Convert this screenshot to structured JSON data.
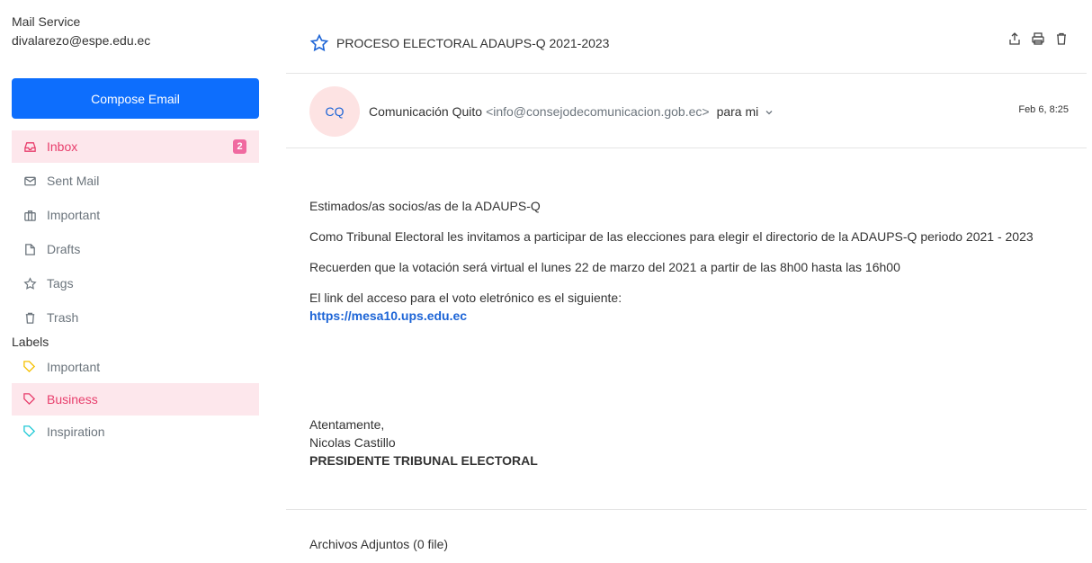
{
  "account": {
    "service": "Mail Service",
    "email": "divalarezo@espe.edu.ec"
  },
  "compose_label": "Compose Email",
  "nav": [
    {
      "label": "Inbox",
      "icon": "inbox-icon",
      "badge": "2",
      "active": true
    },
    {
      "label": "Sent Mail",
      "icon": "envelope-icon"
    },
    {
      "label": "Important",
      "icon": "briefcase-icon"
    },
    {
      "label": "Drafts",
      "icon": "file-icon"
    },
    {
      "label": "Tags",
      "icon": "star-icon"
    },
    {
      "label": "Trash",
      "icon": "trash-icon"
    }
  ],
  "labels_title": "Labels",
  "labels": [
    {
      "label": "Important",
      "color": "#f5c000"
    },
    {
      "label": "Business",
      "color": "#e83e6c",
      "active": true
    },
    {
      "label": "Inspiration",
      "color": "#20c9d6"
    }
  ],
  "message": {
    "subject": "PROCESO ELECTORAL ADAUPS-Q 2021-2023",
    "avatar_initials": "CQ",
    "sender_name": "Comunicación Quito",
    "sender_email": "<info@consejodecomunicacion.gob.ec>",
    "to_label": "para mi",
    "date": "Feb 6, 8:25",
    "greeting": "Estimados/as socios/as de la ADAUPS-Q",
    "p1": "Como Tribunal Electoral les invitamos a participar de las elecciones para elegir el directorio de la ADAUPS-Q periodo 2021 - 2023",
    "p2": "Recuerden que la votación será virtual el lunes 22 de marzo del 2021 a partir de las 8h00 hasta las 16h00",
    "p3": "El link del acceso para el voto eletrónico es el siguiente:",
    "link": "https://mesa10.ups.edu.ec",
    "sig_closing": "Atentamente,",
    "sig_name": "Nicolas Castillo",
    "sig_title": "PRESIDENTE TRIBUNAL ELECTORAL",
    "attachments": "Archivos Adjuntos (0 file)"
  },
  "colors": {
    "accent": "#0d6efd",
    "active_bg": "#fde7ec",
    "active_text": "#e83e6c",
    "badge": "#f06aa0"
  }
}
